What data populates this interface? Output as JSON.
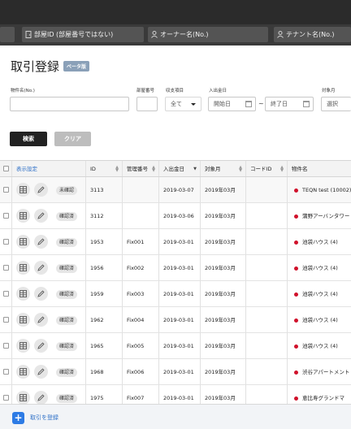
{
  "filter_chips": [
    {
      "label": "部屋ID (部屋番号ではない)"
    },
    {
      "label": "オーナー名(No.)"
    },
    {
      "label": "テナント名(No.)"
    }
  ],
  "page": {
    "title": "取引登録",
    "beta": "ベータ版"
  },
  "filters": {
    "property_label": "物件名(No.)",
    "property_value": "",
    "room_label": "部屋番号",
    "room_value": "",
    "type_label": "収支項目",
    "type_value": "全て",
    "date_label": "入出金日",
    "date_start": "開始日",
    "date_end": "終了日",
    "date_sep": "~",
    "month_label": "対象月",
    "month_value": "選択"
  },
  "buttons": {
    "search": "検索",
    "clear": "クリア"
  },
  "table": {
    "settings_label": "表示設定",
    "columns": [
      "ID",
      "管理番号",
      "入出金日",
      "対象月",
      "コードID",
      "物件名"
    ],
    "rows": [
      {
        "status": "未確認",
        "id": "3113",
        "mgmt": "",
        "date": "2019-03-07",
        "month": "2019年03月",
        "code": "",
        "property": "TEQN test (10002)"
      },
      {
        "status": "確認済",
        "id": "3112",
        "mgmt": "",
        "date": "2019-03-06",
        "month": "2019年03月",
        "code": "",
        "property": "蒲野アーバンタワー"
      },
      {
        "status": "確認済",
        "id": "1953",
        "mgmt": "Fix001",
        "date": "2019-03-01",
        "month": "2019年03月",
        "code": "",
        "property": "池袋ハウス (4)"
      },
      {
        "status": "確認済",
        "id": "1956",
        "mgmt": "Fix002",
        "date": "2019-03-01",
        "month": "2019年03月",
        "code": "",
        "property": "池袋ハウス (4)"
      },
      {
        "status": "確認済",
        "id": "1959",
        "mgmt": "Fix003",
        "date": "2019-03-01",
        "month": "2019年03月",
        "code": "",
        "property": "池袋ハウス (4)"
      },
      {
        "status": "確認済",
        "id": "1962",
        "mgmt": "Fix004",
        "date": "2019-03-01",
        "month": "2019年03月",
        "code": "",
        "property": "池袋ハウス (4)"
      },
      {
        "status": "確認済",
        "id": "1965",
        "mgmt": "Fix005",
        "date": "2019-03-01",
        "month": "2019年03月",
        "code": "",
        "property": "池袋ハウス (4)"
      },
      {
        "status": "確認済",
        "id": "1968",
        "mgmt": "Fix006",
        "date": "2019-03-01",
        "month": "2019年03月",
        "code": "",
        "property": "渋谷アパートメント"
      },
      {
        "status": "確認済",
        "id": "1975",
        "mgmt": "Fix007",
        "date": "2019-03-01",
        "month": "2019年03月",
        "code": "",
        "property": "恵比寿グランドマ"
      }
    ]
  },
  "footer": {
    "add_label": "取引を登録"
  },
  "colors": {
    "accent": "#2d7be5",
    "link": "#2d6fc7",
    "dot": "#d0112b",
    "dark": "#222222"
  }
}
